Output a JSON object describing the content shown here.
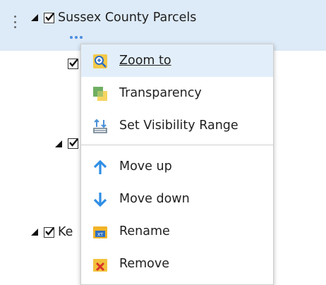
{
  "layer_list": {
    "selected_layer_title": "Sussex County Parcels",
    "truncated_layer_label": "Ke"
  },
  "context_menu": {
    "items": [
      {
        "label": "Zoom to",
        "icon": "zoom-in-icon"
      },
      {
        "label": "Transparency",
        "icon": "transparency-icon"
      },
      {
        "label": "Set Visibility Range",
        "icon": "visibility-range-icon"
      },
      {
        "label": "Move up",
        "icon": "arrow-up-icon"
      },
      {
        "label": "Move down",
        "icon": "arrow-down-icon"
      },
      {
        "label": "Rename",
        "icon": "rename-icon"
      },
      {
        "label": "Remove",
        "icon": "remove-icon"
      }
    ]
  },
  "colors": {
    "selection_bg": "#ddeaf7",
    "hover_bg": "#e2effa",
    "arrow_blue": "#2f8ee5",
    "dots_blue": "#4a8ee0"
  }
}
